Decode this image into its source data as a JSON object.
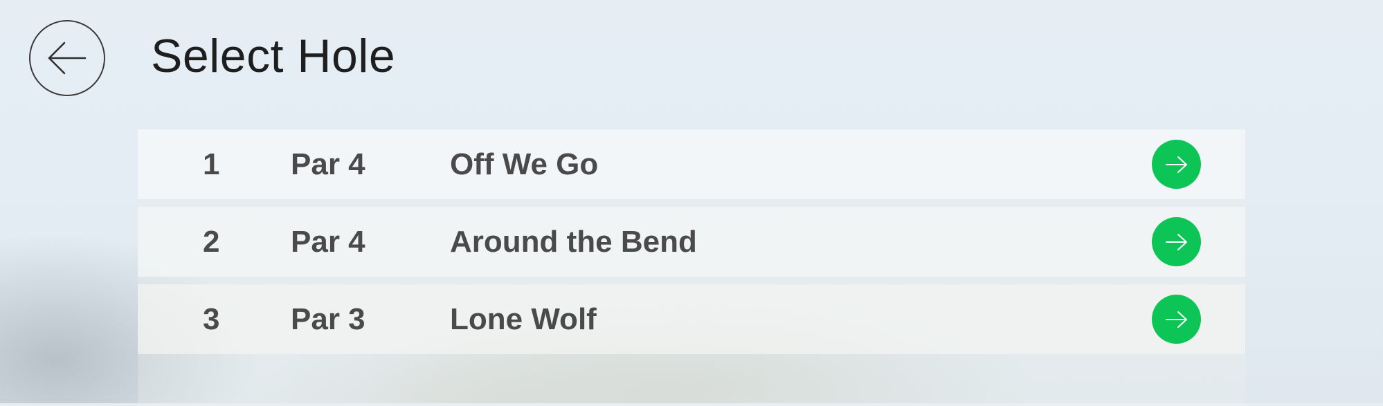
{
  "header": {
    "back_icon": "arrow-left-icon",
    "title": "Select Hole"
  },
  "holes": [
    {
      "number": "1",
      "par": "Par 4",
      "name": "Off We Go",
      "icon": "arrow-right-icon"
    },
    {
      "number": "2",
      "par": "Par 4",
      "name": "Around the Bend",
      "icon": "arrow-right-icon"
    },
    {
      "number": "3",
      "par": "Par 3",
      "name": "Lone Wolf",
      "icon": "arrow-right-icon"
    }
  ],
  "colors": {
    "go_button": "#0dc456",
    "row_text": "#4a4a4a",
    "title_text": "#1e1e1e"
  }
}
